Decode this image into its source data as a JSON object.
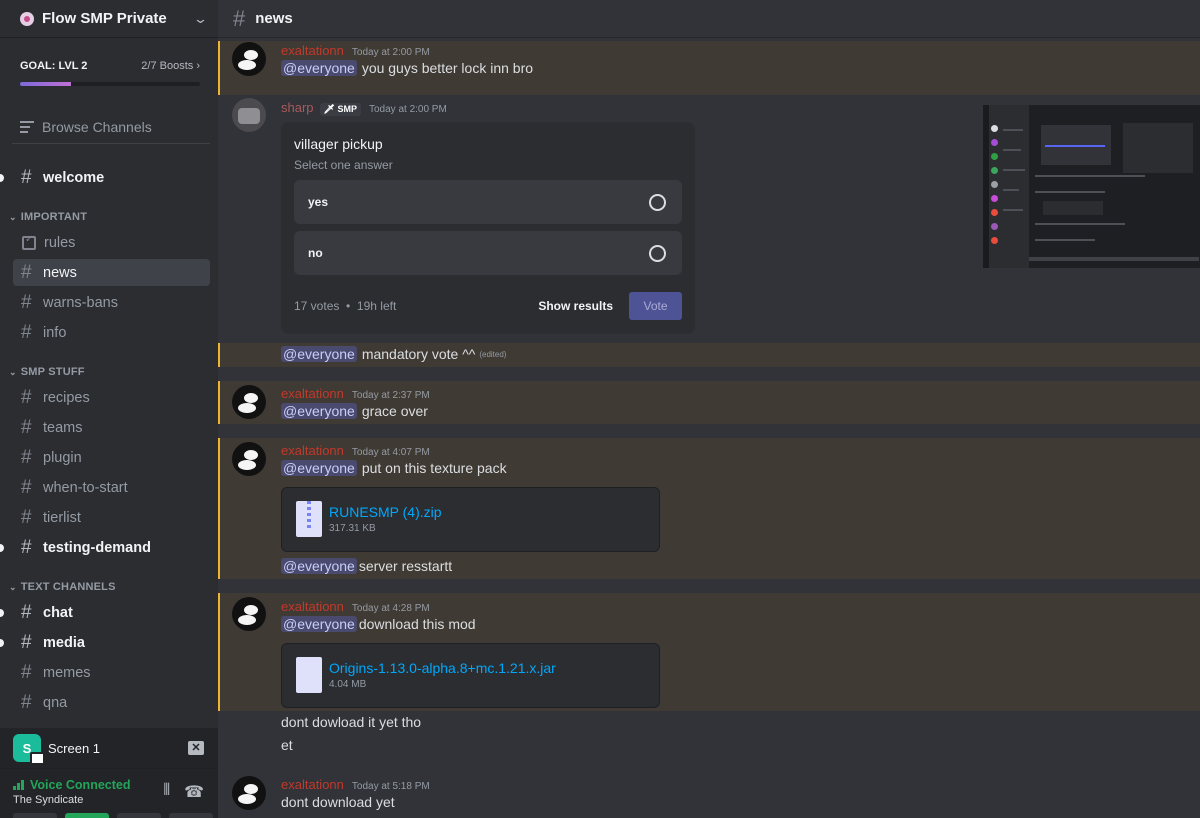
{
  "server": {
    "name": "Flow SMP Private"
  },
  "boost": {
    "goal": "GOAL: LVL 2",
    "count": "2/7 Boosts",
    "progress": 0.2857
  },
  "browse_channels": "Browse Channels",
  "channels": {
    "welcome": "welcome",
    "important_category": "IMPORTANT",
    "rules": "rules",
    "news": "news",
    "warns_bans": "warns-bans",
    "info": "info",
    "smp_category": "SMP STUFF",
    "recipes": "recipes",
    "teams": "teams",
    "plugin": "plugin",
    "when_to_start": "when-to-start",
    "tierlist": "tierlist",
    "testing_demand": "testing-demand",
    "text_category": "TEXT CHANNELS",
    "chat": "chat",
    "media": "media",
    "memes": "memes",
    "qna": "qna"
  },
  "screen_share": {
    "avatar_letter": "S",
    "name": "Screen 1"
  },
  "voice": {
    "status": "Voice Connected",
    "channel": "The Syndicate"
  },
  "header": {
    "channel": "news"
  },
  "mention_label": "@everyone",
  "messages": {
    "m1": {
      "author": "exaltationn",
      "time": "Today at 2:00 PM",
      "text": "you guys better lock inn bro"
    },
    "m2": {
      "author": "sharp",
      "tag": "SMP",
      "time": "Today at 2:00 PM"
    },
    "m3": {
      "text": "mandatory vote ^^",
      "edited": "(edited)"
    },
    "m4": {
      "author": "exaltationn",
      "time": "Today at 2:37 PM",
      "text": "grace over"
    },
    "m5": {
      "author": "exaltationn",
      "time": "Today at 4:07 PM",
      "text": "put on this texture pack",
      "file_name": "RUNESMP (4).zip",
      "file_size": "317.31 KB",
      "followup": "server resstartt"
    },
    "m6": {
      "author": "exaltationn",
      "time": "Today at 4:28 PM",
      "text": "download this mod",
      "file_name": "Origins-1.13.0-alpha.8+mc.1.21.x.jar",
      "file_size": "4.04 MB",
      "followup1": "dont dowload it yet tho",
      "followup2": "et"
    },
    "m7": {
      "author": "exaltationn",
      "time": "Today at 5:18 PM",
      "text": "dont download yet"
    }
  },
  "poll": {
    "question": "villager pickup",
    "subtitle": "Select one answer",
    "options": [
      "yes",
      "no"
    ],
    "votes": "17 votes",
    "separator": "•",
    "time_left": "19h left",
    "show_results": "Show results",
    "vote": "Vote"
  },
  "colors": {
    "accent": "#5865f2",
    "mention_highlight": "#f0b232",
    "online": "#23a55a",
    "link": "#00a8fc"
  }
}
